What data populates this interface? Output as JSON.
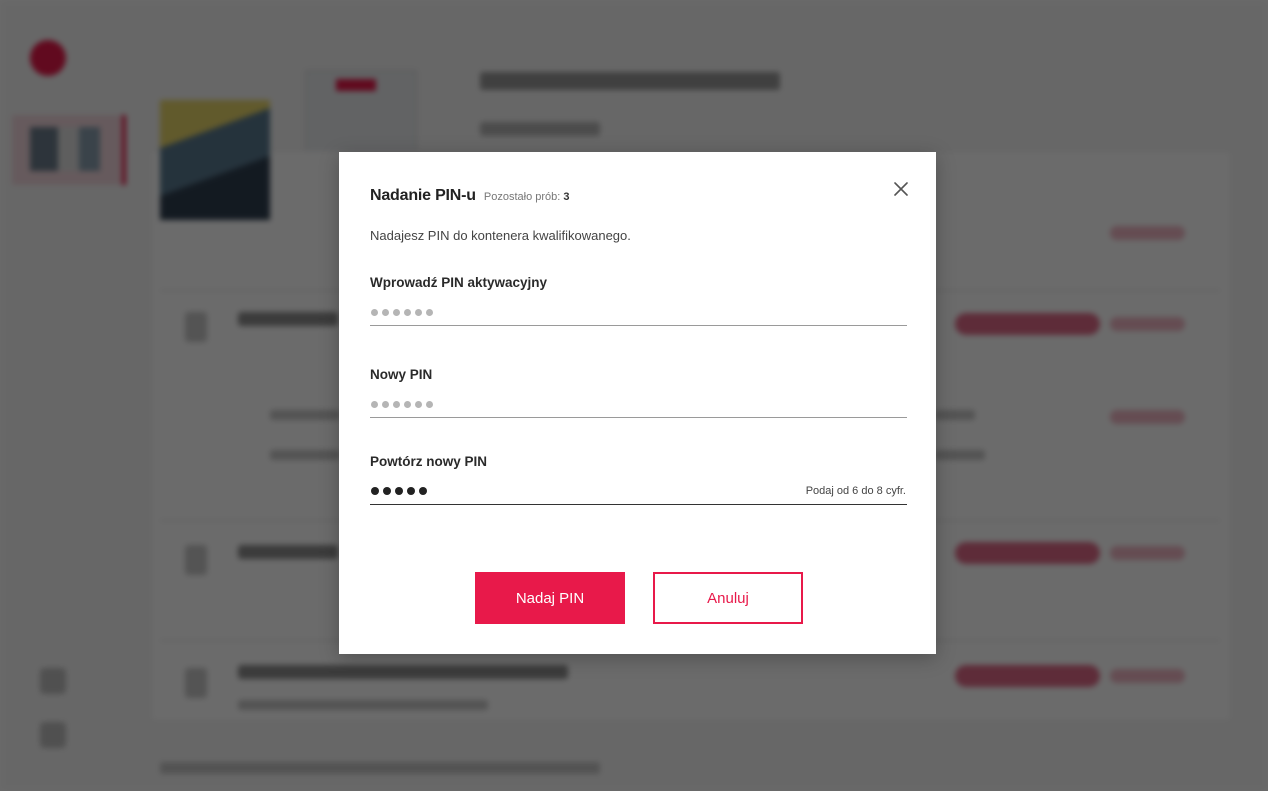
{
  "modal": {
    "title": "Nadanie PIN-u",
    "attempts_label": "Pozostało prób:",
    "attempts_count": "3",
    "description": "Nadajesz PIN do kontenera kwalifikowanego.",
    "close_icon": "close-icon"
  },
  "fields": [
    {
      "label": "Wprowadź PIN aktywacyjny",
      "placeholder_dots": 6,
      "entered_digits": 0,
      "hint": ""
    },
    {
      "label": "Nowy PIN",
      "placeholder_dots": 6,
      "entered_digits": 0,
      "hint": ""
    },
    {
      "label": "Powtórz nowy PIN",
      "placeholder_dots": 6,
      "entered_digits": 5,
      "hint": "Podaj od 6 do 8 cyfr."
    }
  ],
  "buttons": {
    "submit_label": "Nadaj PIN",
    "cancel_label": "Anuluj"
  },
  "colors": {
    "accent": "#e8194a",
    "overlay": "rgba(0,0,0,0.58)",
    "text_primary": "#222222",
    "placeholder_dot": "#b5b5b5"
  }
}
